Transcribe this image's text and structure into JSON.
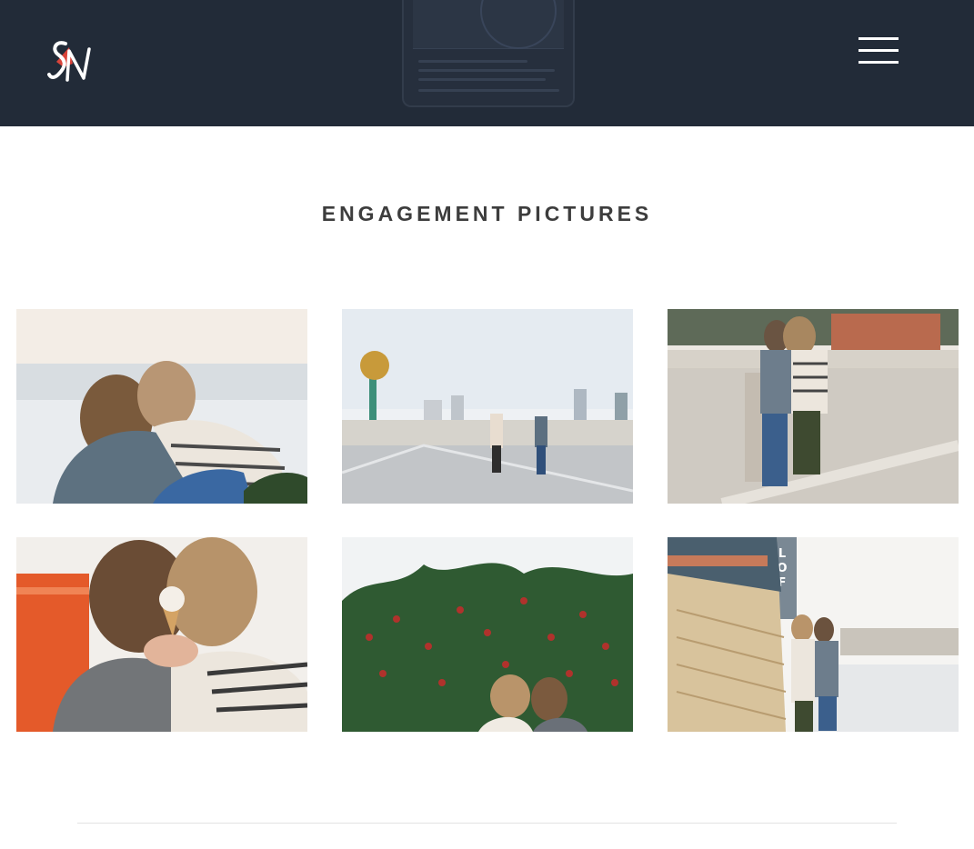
{
  "header": {
    "logo_text": "SN",
    "menu_label": "menu"
  },
  "section": {
    "title": "ENGAGEMENT PICTURES"
  },
  "gallery": {
    "photos": [
      {
        "name": "photo-couple-sitting"
      },
      {
        "name": "photo-skyline-holding-hands"
      },
      {
        "name": "photo-couple-rooftop"
      },
      {
        "name": "photo-ice-cream-kiss"
      },
      {
        "name": "photo-berry-bush"
      },
      {
        "name": "photo-brick-wall-lofts",
        "sign_text": "LOF"
      }
    ]
  },
  "colors": {
    "header_bg": "#222b38",
    "logo_red": "#d9443a",
    "title_text": "#3d3d3d"
  }
}
